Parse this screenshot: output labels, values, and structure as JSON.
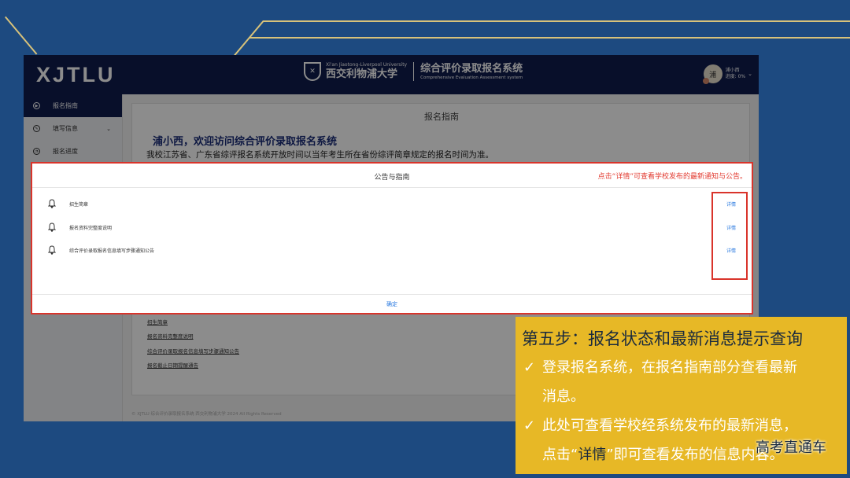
{
  "header": {
    "logo": "XJTLU",
    "brand_en": "Xi'an Jiaotong-Liverpool University",
    "brand_cn": "西交利物浦大学",
    "system_title": "综合评价录取报名系统",
    "system_subtitle": "Comprehensive Evaluation Assessment system",
    "user_name": "浦小西",
    "user_progress": "进度: 0%",
    "avatar_text": "浦"
  },
  "sidebar": {
    "items": [
      {
        "label": "报名指南",
        "icon": "play-circle-icon",
        "active": true
      },
      {
        "label": "填写信息",
        "icon": "edit-icon",
        "expandable": true
      },
      {
        "label": "报名进度",
        "icon": "gauge-icon"
      }
    ]
  },
  "main": {
    "title": "报名指南",
    "welcome": "浦小西，欢迎访问综合评价录取报名系统",
    "description": "我校江苏省、广东省综评报名系统开放时间以当年考生所在省份综评简章规定的报名时间为准。",
    "links": [
      "招生简章",
      "报名资料完整度说明",
      "综合评价录取报名信息填写步骤通知公告",
      "报名截止日期提醒通告"
    ],
    "footer": "© XJTLU 综合评价录取报名系统 西交利物浦大学 2024 All Rights Reserved"
  },
  "modal": {
    "title": "公告与指南",
    "note": "点击“详情”可查看学校发布的最新通知与公告。",
    "notices": [
      {
        "label": "招生简章",
        "detail": "详情"
      },
      {
        "label": "报名资料完整度说明",
        "detail": "详情"
      },
      {
        "label": "综合评价录取报名信息填写步骤通知公告",
        "detail": "详情"
      }
    ],
    "close": "确定"
  },
  "callout": {
    "title": "第五步：报名状态和最新消息提示查询",
    "point1_line1": "登录报名系统，在报名指南部分查看最新",
    "point1_line2": "消息。",
    "point2_line1": "此处可查看学校经系统发布的最新消息，",
    "point2_pre": "点击“",
    "point2_hl": "详情",
    "point2_post": "”即可查看发布的信息内容。",
    "check": "✓"
  },
  "watermark": "高考直通车",
  "colors": {
    "background": "#1d4a80",
    "header": "#101c4e",
    "highlight": "#d9342b",
    "callout": "#e7b826",
    "link": "#2c7be0"
  }
}
